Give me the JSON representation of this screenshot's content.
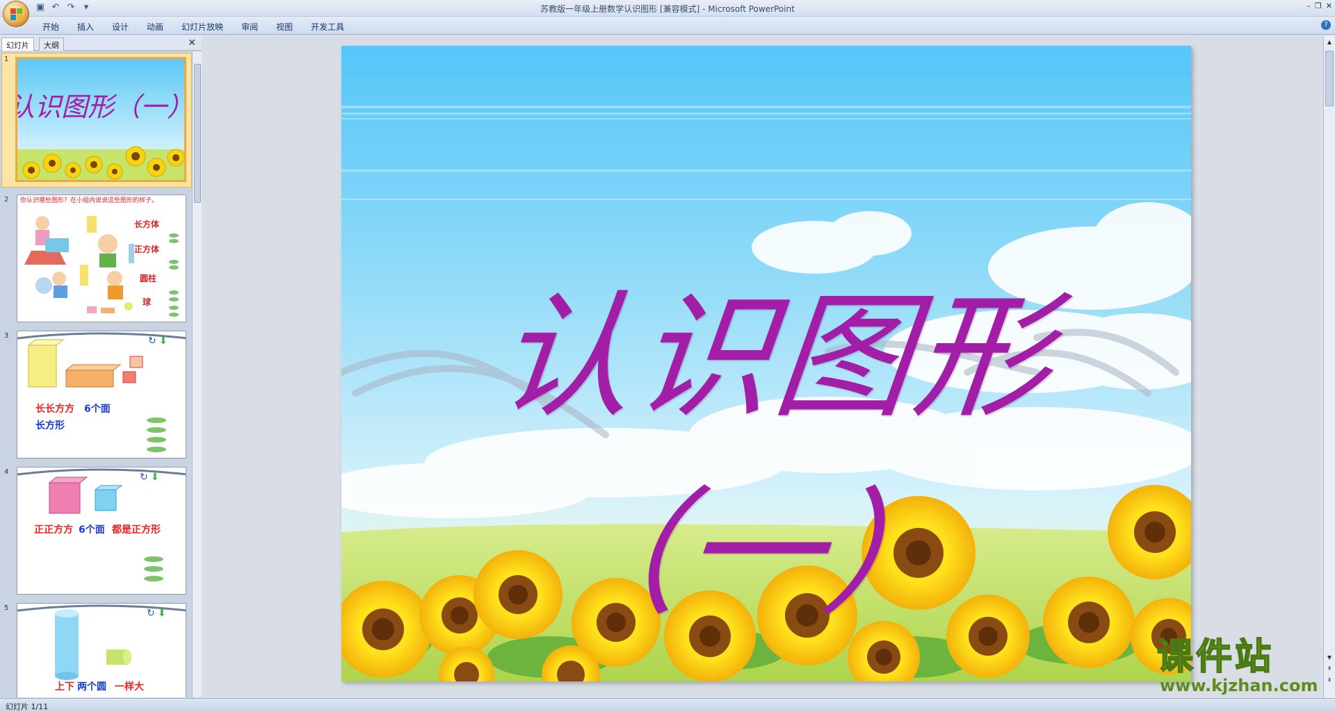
{
  "window": {
    "title": "苏教版一年级上册数学认识图形 [兼容模式] - Microsoft PowerPoint"
  },
  "ribbon": {
    "tabs": [
      "开始",
      "插入",
      "设计",
      "动画",
      "幻灯片放映",
      "审阅",
      "视图",
      "开发工具"
    ]
  },
  "left_pane": {
    "tabs": [
      "幻灯片",
      "大纲"
    ],
    "thumbnails": [
      {
        "number": "1",
        "title": "认识图形（一）"
      },
      {
        "number": "2",
        "heading": "你认识哪些图形？在小组内说说这些图形的样子。",
        "labels": [
          "长方体",
          "正方体",
          "圆柱",
          "球"
        ]
      },
      {
        "number": "3",
        "line1": "长长方方",
        "line1b": "6个面",
        "line2": "长方形"
      },
      {
        "number": "4",
        "line1a": "正正方方",
        "line1b": "6个面",
        "line1c": "都是正方形"
      },
      {
        "number": "5",
        "line1a": "上下",
        "line1b": "两个圆",
        "line1c": "一样大"
      }
    ]
  },
  "slide": {
    "title": "认识图形（一）"
  },
  "watermark": {
    "name": "课件站",
    "url": "www.kjzhan.com"
  },
  "status_bar": {
    "text": "幻灯片 1/11"
  }
}
